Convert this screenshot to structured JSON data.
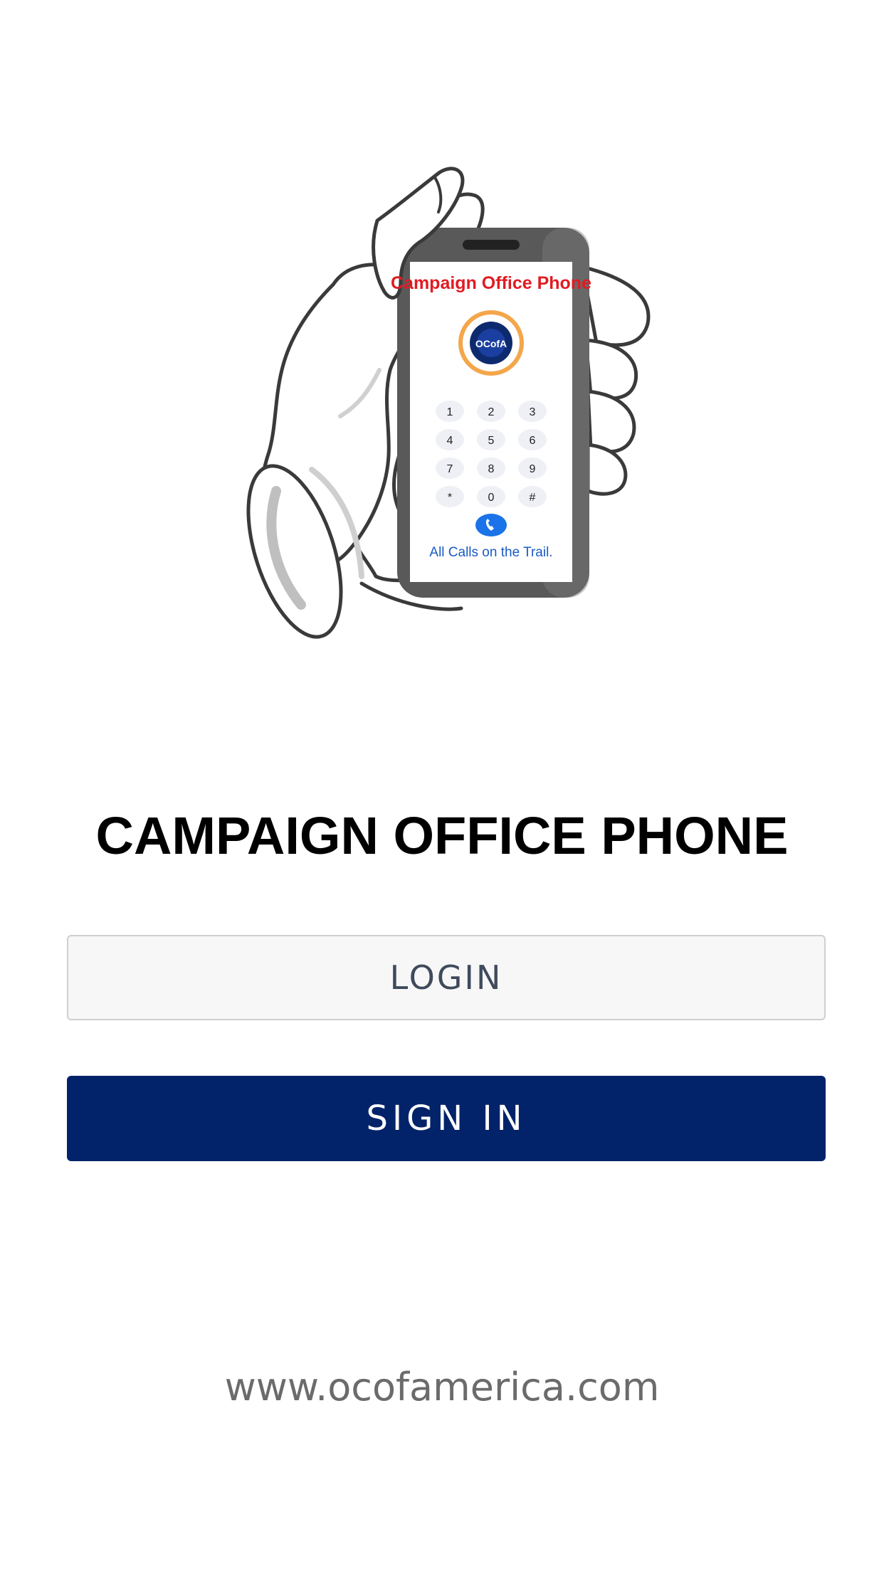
{
  "hero": {
    "screen_title": "Campaign Office Phone",
    "logo_text": "OCofA",
    "keypad": [
      "1",
      "2",
      "3",
      "4",
      "5",
      "6",
      "7",
      "8",
      "9",
      "*",
      "0",
      "#"
    ],
    "tagline": "All Calls on the Trail.",
    "icons": [
      "hand-holding-phone-illustration",
      "phone-call-icon"
    ]
  },
  "title": "CAMPAIGN OFFICE PHONE",
  "login": {
    "placeholder": "LOGIN",
    "value": ""
  },
  "signin_button": {
    "label": "SIGN IN"
  },
  "website": "www.ocofamerica.com",
  "colors": {
    "background": "#ffffff",
    "primary_button": "#022369",
    "title_text": "#000000",
    "website_text": "#6b6b6b",
    "screen_title_red": "#e11b22",
    "tagline_blue": "#1a5bc4",
    "call_button_blue": "#1a73e8"
  }
}
